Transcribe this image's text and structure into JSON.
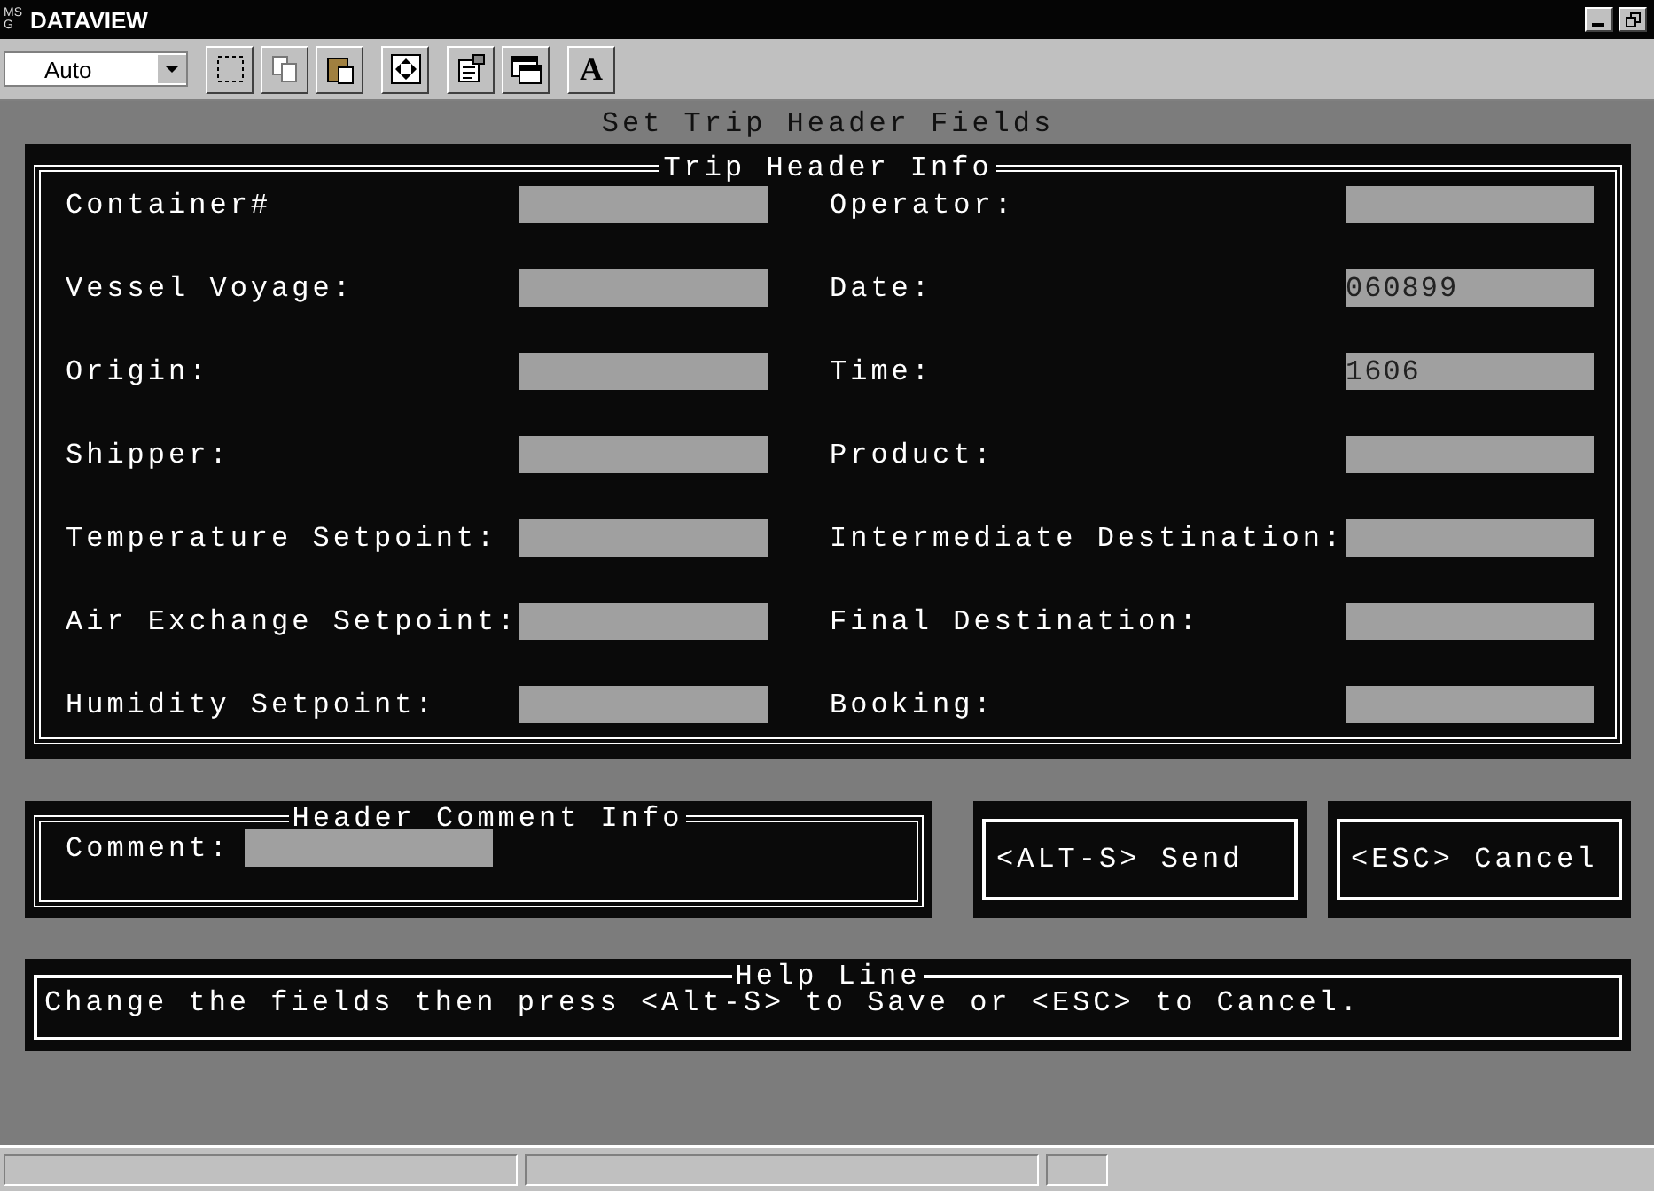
{
  "window": {
    "title": "DATAVIEW",
    "logo": "MSG"
  },
  "toolbar": {
    "zoom_select": {
      "value": "Auto"
    },
    "font_button": "A"
  },
  "form": {
    "title": "Set Trip Header Fields",
    "trip_header": {
      "legend": "Trip Header Info",
      "rows": [
        {
          "left": {
            "label": "Container#"
          },
          "right": {
            "label": "Operator:"
          }
        },
        {
          "left": {
            "label": "Vessel Voyage:"
          },
          "right": {
            "label": "Date:",
            "value": "060899"
          }
        },
        {
          "left": {
            "label": "Origin:"
          },
          "right": {
            "label": "Time:",
            "value": "1606"
          }
        },
        {
          "left": {
            "label": "Shipper:"
          },
          "right": {
            "label": "Product:"
          }
        },
        {
          "left": {
            "label": "Temperature Setpoint:"
          },
          "right": {
            "label": "Intermediate Destination:"
          }
        },
        {
          "left": {
            "label": "Air Exchange Setpoint:"
          },
          "right": {
            "label": "Final Destination:"
          }
        },
        {
          "left": {
            "label": "Humidity Setpoint:"
          },
          "right": {
            "label": "Booking:"
          }
        }
      ]
    },
    "comment": {
      "legend": "Header Comment Info",
      "label": "Comment:"
    },
    "buttons": [
      "<ALT-S> Send",
      "<ESC> Cancel"
    ],
    "help": {
      "legend": "Help Line",
      "text": "Change the fields then press <Alt-S> to Save or <ESC> to Cancel."
    }
  }
}
